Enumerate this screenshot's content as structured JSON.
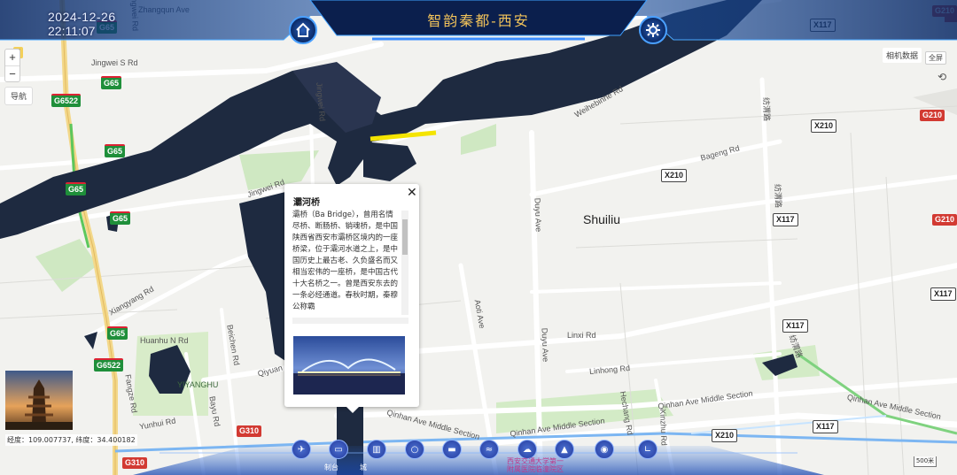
{
  "header": {
    "date": "2024-12-26",
    "time": "22:11:07",
    "title": "智韵秦都-西安",
    "home_icon": "home-icon",
    "settings_icon": "gear-icon"
  },
  "controls": {
    "zoom_in": "+",
    "zoom_out": "−",
    "nav": "导航",
    "camera_data": "相机数据",
    "fullscreen": "全屏",
    "scale": "500米"
  },
  "map": {
    "places": [
      {
        "name": "Shuiliu"
      }
    ],
    "road_labels": [
      "Zhangqun Ave",
      "Jingwei S Rd",
      "Jingwei Rd",
      "Jingwei Rd",
      "Weihebinhe Rd",
      "Bageng Rd",
      "Xiangyang Rd",
      "Huanhu N Rd",
      "Fangze Rd",
      "Yunhui Rd",
      "Beichen Rd",
      "Qiyuan 2nd Rd",
      "Bayu Rd",
      "Linxi Rd",
      "Linhong Rd",
      "Qinhan Ave Middle Section",
      "Qinhan Ave Middle Section",
      "Qinhan Ave Middle Section",
      "Qinhan Ave Middle Section",
      "Duyu Ave",
      "Duyu Ave",
      "Aoti Ave",
      "Xinzhu Rd",
      "Hechang Rd",
      "纺渭路",
      "纺渭路",
      "纺渭路",
      "Jingwei Rd",
      "YIYANGHU"
    ],
    "shields_green": [
      "G65",
      "G65",
      "G65",
      "G65",
      "G65",
      "G6522",
      "G6522",
      "G65"
    ],
    "shields_white": [
      "X117",
      "X210",
      "X210",
      "X117",
      "X117",
      "X117",
      "X210",
      "X117"
    ],
    "shields_red": [
      "G210",
      "G210",
      "G210",
      "G310",
      "G310"
    ],
    "yellow_label": "5"
  },
  "popup": {
    "title": "灞河桥",
    "body": "灞桥（Ba Bridge），曾用名情尽桥、断肠桥、销魂桥，是中国陕西省西安市灞桥区境内的一座桥梁，位于灞河水道之上，是中国历史上最古老、久负盛名而又相当宏伟的一座桥，是中国古代十大名桥之一。曾是西安东去的一条必经通道。春秋时期，秦穆公称霸",
    "close_icon": "close-icon",
    "image_icon": "bridge-photo"
  },
  "status": {
    "coords": "经度：109.007737, 纬度：34.400182"
  },
  "toolbar": {
    "buttons": [
      {
        "icon": "map-icon"
      },
      {
        "icon": "monitor-icon"
      },
      {
        "icon": "building-icon"
      },
      {
        "icon": "search-icon"
      },
      {
        "icon": "car-icon"
      },
      {
        "icon": "boat-icon"
      },
      {
        "icon": "weather-icon"
      },
      {
        "icon": "mountain-icon"
      },
      {
        "icon": "fish-icon"
      },
      {
        "icon": "chart-icon"
      }
    ],
    "labels": [
      "制台",
      "城",
      "西安交通大学第一附属医院临潼院区"
    ]
  }
}
